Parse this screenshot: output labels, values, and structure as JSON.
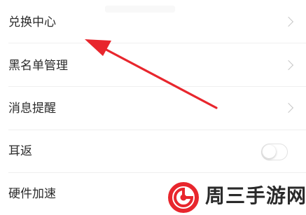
{
  "settings": {
    "items": [
      {
        "label": "兑换中心",
        "control": "chevron"
      },
      {
        "label": "黑名单管理",
        "control": "chevron"
      },
      {
        "label": "消息提醒",
        "control": "chevron"
      },
      {
        "label": "耳返",
        "control": "toggle",
        "toggle_on": false
      },
      {
        "label": "硬件加速",
        "control": "none"
      }
    ]
  },
  "annotation": {
    "arrow_color": "#e8262d"
  },
  "watermark": {
    "text": "周三手游网",
    "logo_color": "#e8262d"
  }
}
